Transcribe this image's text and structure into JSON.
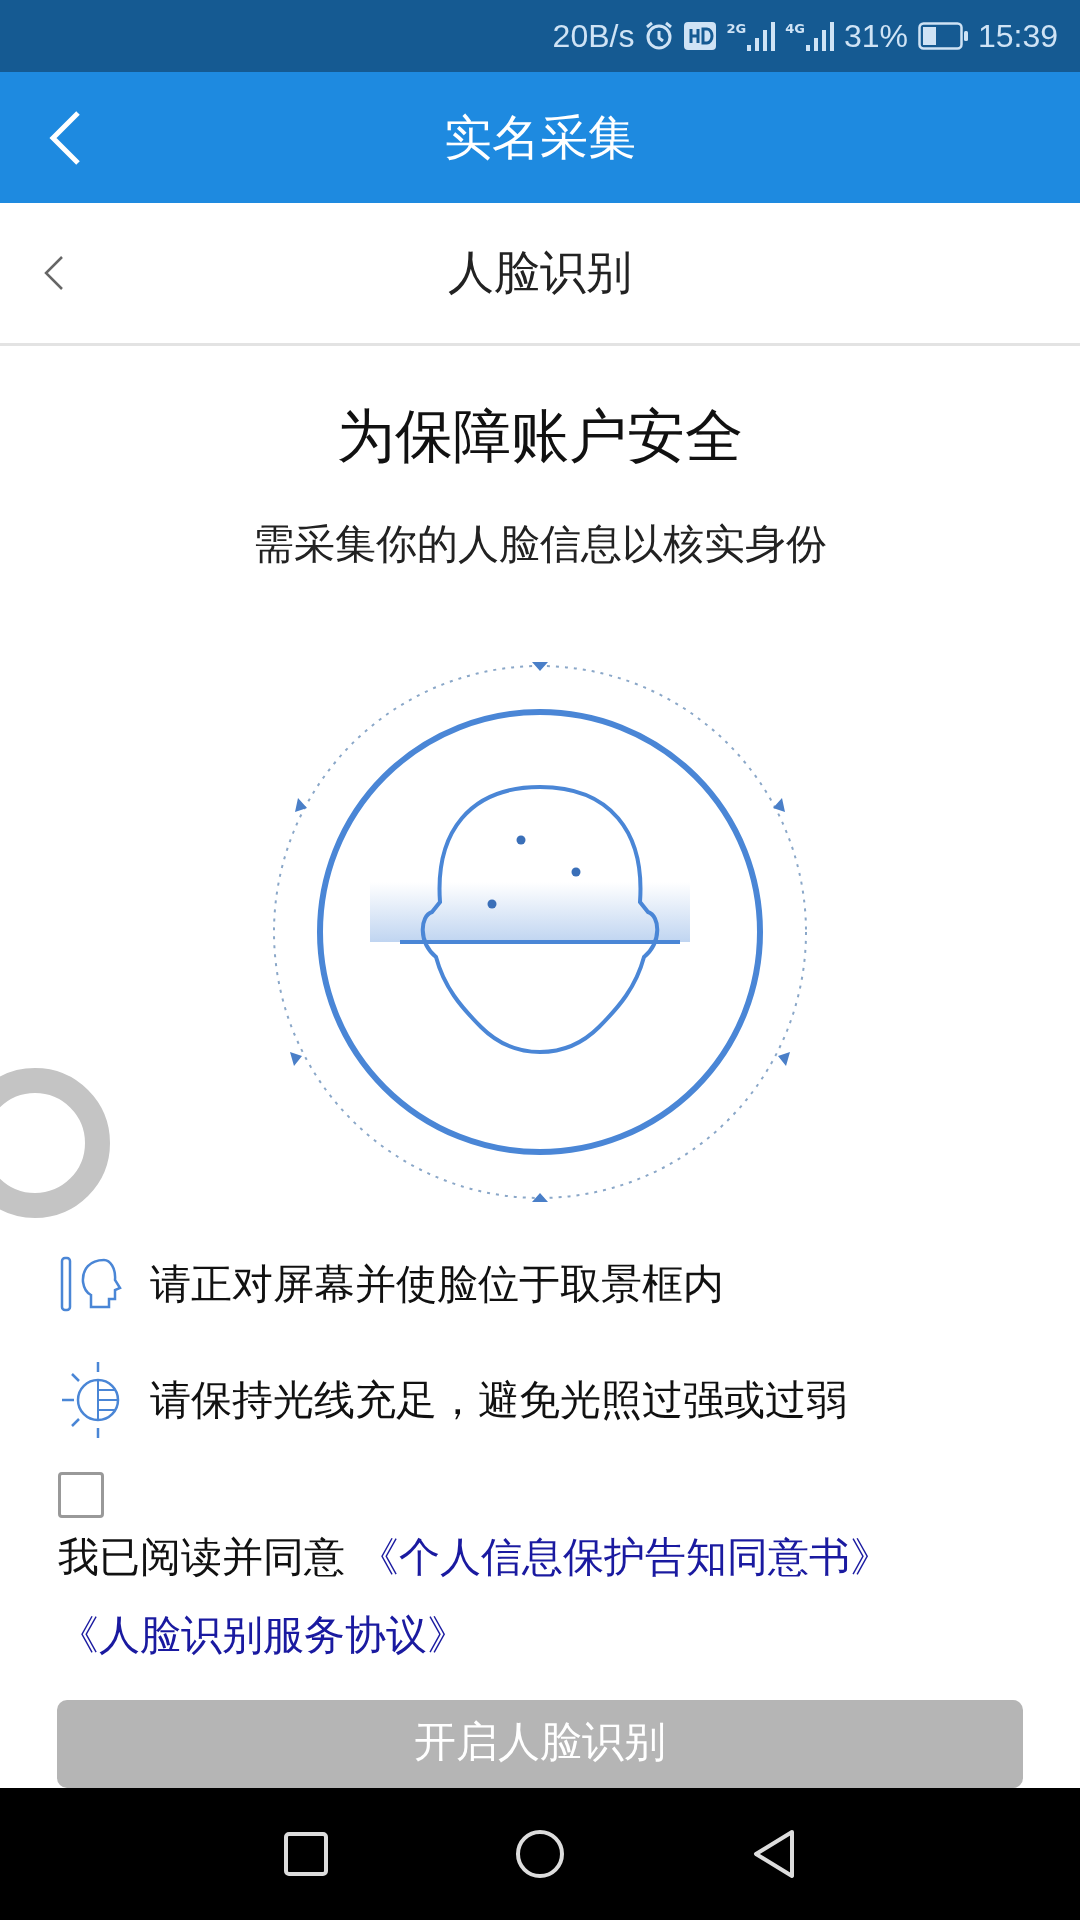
{
  "status_bar": {
    "network_speed": "20B/s",
    "network_labels": [
      "2G",
      "4G"
    ],
    "battery_percent": "31%",
    "time": "15:39"
  },
  "header": {
    "title": "实名采集"
  },
  "subheader": {
    "title": "人脸识别"
  },
  "heading": "为保障账户安全",
  "subtitle": "需采集你的人脸信息以核实身份",
  "tips": [
    {
      "kind": "face",
      "text": "请正对屏幕并使脸位于取景框内"
    },
    {
      "kind": "light",
      "text": "请保持光线充足，避免光照过强或过弱"
    }
  ],
  "agreement": {
    "checked": false,
    "text": "我已阅读并同意",
    "links": [
      "《个人信息保护告知同意书》",
      "《人脸识别服务协议》"
    ]
  },
  "button": {
    "label": "开启人脸识别",
    "disabled": true
  }
}
